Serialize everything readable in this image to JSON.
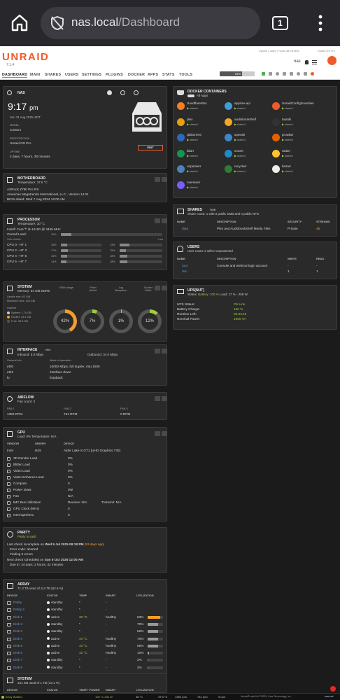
{
  "browser": {
    "url_host": "nas.local",
    "url_path": "/Dashboard",
    "tab_count": "1"
  },
  "header": {
    "logo": "UNRAID",
    "version": "7.1.4",
    "uptime": "Uptime 2 days 7 hours 38 minutes",
    "license": "Unraid OS Pro",
    "server_name": "nas",
    "brand_color": "#f15a2c"
  },
  "nav": {
    "items": [
      "DASHBOARD",
      "MAIN",
      "SHARES",
      "USERS",
      "SETTINGS",
      "PLUGINS",
      "DOCKER",
      "APPS",
      "STATS",
      "TOOLS"
    ],
    "load": "63%"
  },
  "nas_panel": {
    "title": "NAS",
    "time": "9:17",
    "ampm": "pm",
    "date": "Sun 31 Aug 2025, EDT",
    "model_label": "MODEL",
    "model": "Custom",
    "reg_label": "REGISTRATION",
    "reg": "Unraid OS Pro",
    "uptime_label": "UPTIME",
    "uptime": "2 days, 7 hours, 38 minutes",
    "edit": "EDIT"
  },
  "motherboard": {
    "title": "MOTHERBOARD",
    "temp": "Temperature: 37.5 °C",
    "name": "ASRock Z790 Pro RS",
    "bios": "American Megatrends International, LLC., Version 14.01",
    "bios_date": "BIOS dated: Wed 7 Aug 2024 12:00 AM"
  },
  "processor": {
    "title": "PROCESSOR",
    "temp": "Temperature: 30 °C",
    "name": "Intel® Core™ i5-14100 @ 3465 MHz",
    "overall_label": "Overall Load:",
    "overall": "10%",
    "overall_pct": 10,
    "hide": "Hide details",
    "last": "Last",
    "cpus": [
      {
        "l": "CPU 0 - HT 1",
        "v": "15%",
        "p": 15,
        "v2": "23%",
        "p2": 23
      },
      {
        "l": "CPU 2 - HT 3",
        "v": "17%",
        "p": 17,
        "v2": "15%",
        "p2": 15
      },
      {
        "l": "CPU 4 - HT 5",
        "v": "15%",
        "p": 15,
        "v2": "18%",
        "p2": 18
      },
      {
        "l": "CPU 6 - HT 7",
        "v": "14%",
        "p": 14,
        "v2": "18%",
        "p2": 18
      }
    ]
  },
  "system": {
    "title": "SYSTEM",
    "memory": "Memory: 64 GiB DDR5",
    "usable": "Usable size: 63 GiB",
    "max": "Maximum size: 128 GiB",
    "ram_label": "RAM usage",
    "flash_label": "Flash device",
    "log_label": "Log filesystem",
    "docker_label": "Docker folder",
    "ram": "42%",
    "ram_pct": 42,
    "flash": "7%",
    "flash_pct": 7,
    "log": "1%",
    "log_pct": 1,
    "docker": "12%",
    "docker_pct": 12,
    "legend_title": "Legend",
    "legend": [
      "System: 1.70 GB",
      "Docker: 24.4 GB",
      "Free: 36.5 GB"
    ]
  },
  "interface": {
    "title": "INTERFACE",
    "iface": "eth0",
    "inbound": "Inbound: 5.8 Mbps",
    "outbound": "Outbound: 34.0 Mbps",
    "col1": "General info",
    "col2": "Mode of operation",
    "rows": [
      {
        "k": "eth0",
        "v": "10000 Mbps, full duplex, mtu 1500"
      },
      {
        "k": "eth1",
        "v": "interface down"
      },
      {
        "k": "lo",
        "v": "loopback"
      }
    ]
  },
  "airflow": {
    "title": "AIRFLOW",
    "count": "Fan count: 3",
    "fans": [
      {
        "k": "FAN 1",
        "v": "1352 RPM"
      },
      {
        "k": "FAN 2",
        "v": "761 RPM"
      },
      {
        "k": "FAN 3",
        "v": "0 RPM"
      }
    ]
  },
  "gpu": {
    "title": "GPU",
    "load": "Load: 0% Temperature: N/A",
    "h_vendor": "VENDOR",
    "h_driver": "DRIVER",
    "h_device": "DEVICE",
    "vendor": "Intel",
    "driver": "i915",
    "device": "Alder Lake-S GT1 [UHD Graphics 730]",
    "rows": [
      {
        "k": "3D Render Load",
        "v": "0%"
      },
      {
        "k": "Blitter Load",
        "v": "0%"
      },
      {
        "k": "Video Load",
        "v": "0%"
      },
      {
        "k": "Video Enhance Load",
        "v": "0%"
      },
      {
        "k": "Compute",
        "v": "0"
      },
      {
        "k": "Power Draw",
        "v": "0W"
      },
      {
        "k": "Fan",
        "v": "N/A"
      },
      {
        "k": "IMC Bus Utilization",
        "v": "Receive: N/A",
        "v2": "Transmit: N/A"
      },
      {
        "k": "GPU Clock (MHz)",
        "v": "0"
      },
      {
        "k": "Interrupts/Sec.",
        "v": "0"
      }
    ]
  },
  "parity": {
    "title": "PARITY",
    "sub": "Parity is valid",
    "line1a": "Last check incomplete on ",
    "line1b": "Wed 9 Jul 2025 09:18 PM",
    "line1c": " (53 days ago)",
    "error": "Error code: aborted",
    "finding": "Finding 0 errors",
    "next_a": "Next check scheduled on ",
    "next_b": "Sun 5 Oct 2025 12:00 AM",
    "due": "Due in: 34 days, 2 hours, 42 minutes"
  },
  "array": {
    "title": "ARRAY",
    "sub": "71.3 TB used of 114 TB (62.6 %)",
    "headers": [
      "DEVICE",
      "STATUS",
      "TEMP",
      "SMART",
      "UTILIZATION"
    ],
    "rows": [
      {
        "d": "Parity",
        "s": "standby",
        "t": "*",
        "m": "-",
        "u": ""
      },
      {
        "d": "Parity 2",
        "s": "standby",
        "t": "*",
        "m": "-",
        "u": ""
      },
      {
        "d": "Disk 1",
        "s": "active",
        "t": "30 °C",
        "m": "healthy",
        "u": "83%"
      },
      {
        "d": "Disk 2",
        "s": "standby",
        "t": "*",
        "m": "-",
        "u": "70%"
      },
      {
        "d": "Disk 3",
        "s": "standby",
        "t": "*",
        "m": "-",
        "u": "69%"
      },
      {
        "d": "Disk 4",
        "s": "active",
        "t": "34 °C",
        "m": "healthy",
        "u": "70%"
      },
      {
        "d": "Disk 5",
        "s": "active",
        "t": "34 °C",
        "m": "healthy",
        "u": "69%"
      },
      {
        "d": "Disk 6",
        "s": "active",
        "t": "32 °C",
        "m": "healthy",
        "u": "10%"
      },
      {
        "d": "Disk 7",
        "s": "standby",
        "t": "*",
        "m": "-",
        "u": "2%"
      },
      {
        "d": "Disk 8",
        "s": "standby",
        "t": "*",
        "m": "-",
        "u": "2%"
      }
    ]
  },
  "system2": {
    "title": "SYSTEM",
    "sub": "131 GB used of 1 TB (13.1 %)",
    "headers": [
      "DEVICE",
      "STATUS",
      "TEMP / POWER",
      "SMART",
      "UTILIZATION"
    ]
  },
  "docker": {
    "title": "DOCKER CONTAINERS",
    "toggle": "All Apps",
    "containers": [
      {
        "n": "cloudflaredtns",
        "s": "started",
        "c": "#f48120"
      },
      {
        "n": "apprise-api",
        "s": "started",
        "c": "#3aa0d6"
      },
      {
        "n": "UnraidConfigGuardian",
        "s": "started",
        "c": "#f15a2c"
      },
      {
        "n": "plex",
        "s": "started",
        "c": "#e5a00d"
      },
      {
        "n": "audiobookshelf",
        "s": "started",
        "c": "#f5a623"
      },
      {
        "n": "tautulli",
        "s": "started",
        "c": "#333"
      },
      {
        "n": "qbittorrent",
        "s": "started",
        "c": "#2f67ba"
      },
      {
        "n": "speedtr",
        "s": "started",
        "c": "#3d86c8"
      },
      {
        "n": "prowlarr",
        "s": "started",
        "c": "#e66000"
      },
      {
        "n": "lidarr",
        "s": "started",
        "c": "#159552"
      },
      {
        "n": "sonarr",
        "s": "started",
        "c": "#1e8bc3"
      },
      {
        "n": "radarr",
        "s": "started",
        "c": "#ffc230"
      },
      {
        "n": "unpackerr",
        "s": "started",
        "c": "#4b82b8"
      },
      {
        "n": "recyclarr",
        "s": "started",
        "c": "#2e7d32"
      },
      {
        "n": "bazarr",
        "s": "started",
        "c": "#eee"
      },
      {
        "n": "overseerr",
        "s": "started",
        "c": "#7b5cff"
      }
    ]
  },
  "shares": {
    "title": "SHARES",
    "filter": "SMB",
    "sub": "Share count: 1 with 0 public SMB and 0 public NFS",
    "headers": [
      "NAME",
      "DESCRIPTION",
      "SECURITY",
      "STREAMS"
    ],
    "name": "data",
    "desc": "Plex and Audiobookshelf Media Files",
    "sec": "Private",
    "streams": "45"
  },
  "users": {
    "title": "USERS",
    "sub": "User count: 2 with 0 unprotected",
    "headers": [
      "NAME",
      "DESCRIPTION",
      "WRITE",
      "READ"
    ],
    "rows": [
      {
        "n": "root",
        "d": "Console and webGui login account",
        "w": "-",
        "r": "-"
      },
      {
        "n": "doc",
        "d": "",
        "w": "1",
        "r": "1"
      }
    ]
  },
  "ups": {
    "title": "UPS(NUT)",
    "sub_a": "Status: ",
    "sub_b": "Battery: 100 %",
    "sub_c": " Load: 17 % - 255 W",
    "rows": [
      {
        "k": "UPS Status:",
        "v": "On Line"
      },
      {
        "k": "Battery Charge:",
        "v": "100 %"
      },
      {
        "k": "Runtime Left:",
        "v": "00:33:18"
      },
      {
        "k": "Nominal Power:",
        "v": "1500 VA"
      }
    ]
  },
  "status": {
    "array": "Array Started",
    "temps": "100 °C  233 W",
    "t1": "38 °C",
    "t2": "37.5 °C",
    "f1": "1352 rpm",
    "f2": "761 rpm",
    "f3": "0 rpm",
    "copyright": "Unraid® webGui ©2025, Lime Technology, Inc.",
    "manual": "manual"
  }
}
